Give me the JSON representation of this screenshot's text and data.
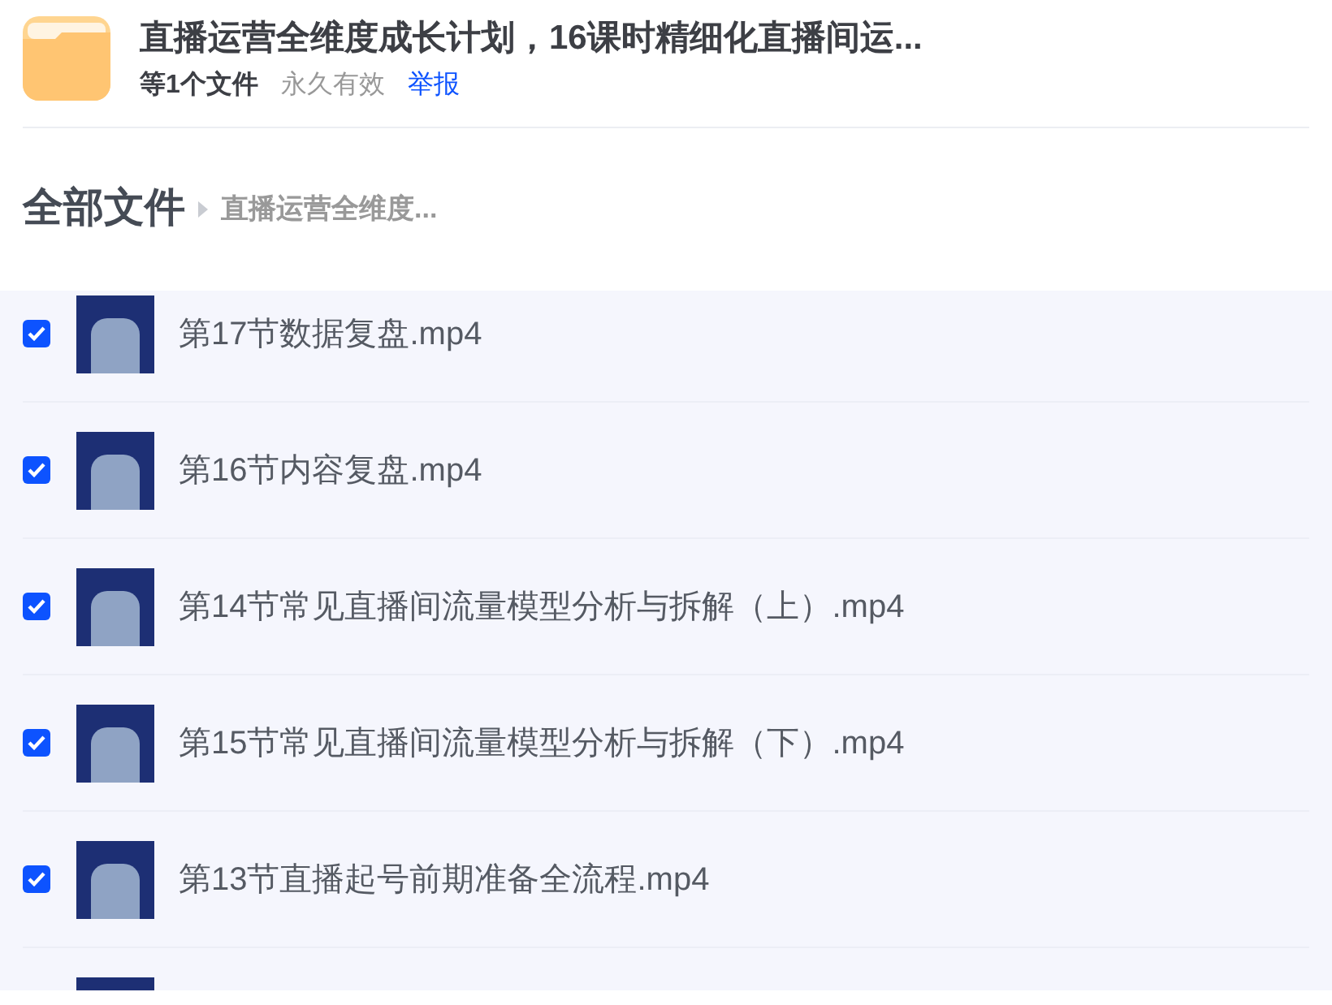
{
  "share": {
    "title": "直播运营全维度成长计划，16课时精细化直播间运...",
    "file_count": "等1个文件",
    "validity": "永久有效",
    "report_link": "举报"
  },
  "breadcrumb": {
    "root": "全部文件",
    "current": "直播运营全维度..."
  },
  "files": [
    {
      "kind": "file",
      "name": "第17节数据复盘.mp4",
      "checked": true
    },
    {
      "kind": "file",
      "name": "第16节内容复盘.mp4",
      "checked": true
    },
    {
      "kind": "file",
      "name": "第14节常见直播间流量模型分析与拆解（上）.mp4",
      "checked": true
    },
    {
      "kind": "file",
      "name": "第15节常见直播间流量模型分析与拆解（下）.mp4",
      "checked": true
    },
    {
      "kind": "file",
      "name": "第13节直播起号前期准备全流程.mp4",
      "checked": true
    },
    {
      "kind": "cut_off"
    }
  ]
}
